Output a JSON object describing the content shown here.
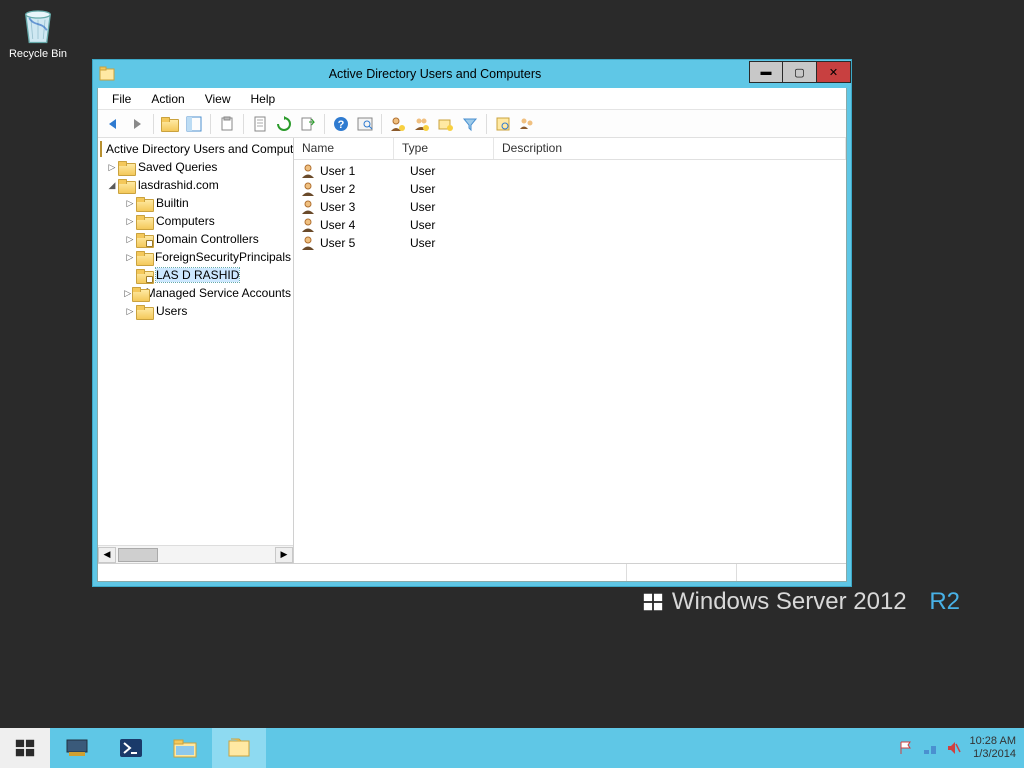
{
  "desktop": {
    "recycle_label": "Recycle Bin"
  },
  "watermark": {
    "text": "Windows Server 2012",
    "suffix": "R2"
  },
  "window": {
    "title": "Active Directory Users and Computers",
    "menus": {
      "file": "File",
      "action": "Action",
      "view": "View",
      "help": "Help"
    },
    "tree": {
      "root": "Active Directory Users and Computers",
      "saved": "Saved Queries",
      "domain": "lasdrashid.com",
      "builtin": "Builtin",
      "computers": "Computers",
      "dc": "Domain Controllers",
      "fsp": "ForeignSecurityPrincipals",
      "selected": "LAS D RASHID",
      "msa": "Managed Service Accounts",
      "users": "Users"
    },
    "columns": {
      "name": "Name",
      "type": "Type",
      "desc": "Description"
    },
    "rows": [
      {
        "name": "User 1",
        "type": "User"
      },
      {
        "name": "User 2",
        "type": "User"
      },
      {
        "name": "User 3",
        "type": "User"
      },
      {
        "name": "User 4",
        "type": "User"
      },
      {
        "name": "User 5",
        "type": "User"
      }
    ]
  },
  "tray": {
    "time": "10:28 AM",
    "date": "1/3/2014"
  }
}
